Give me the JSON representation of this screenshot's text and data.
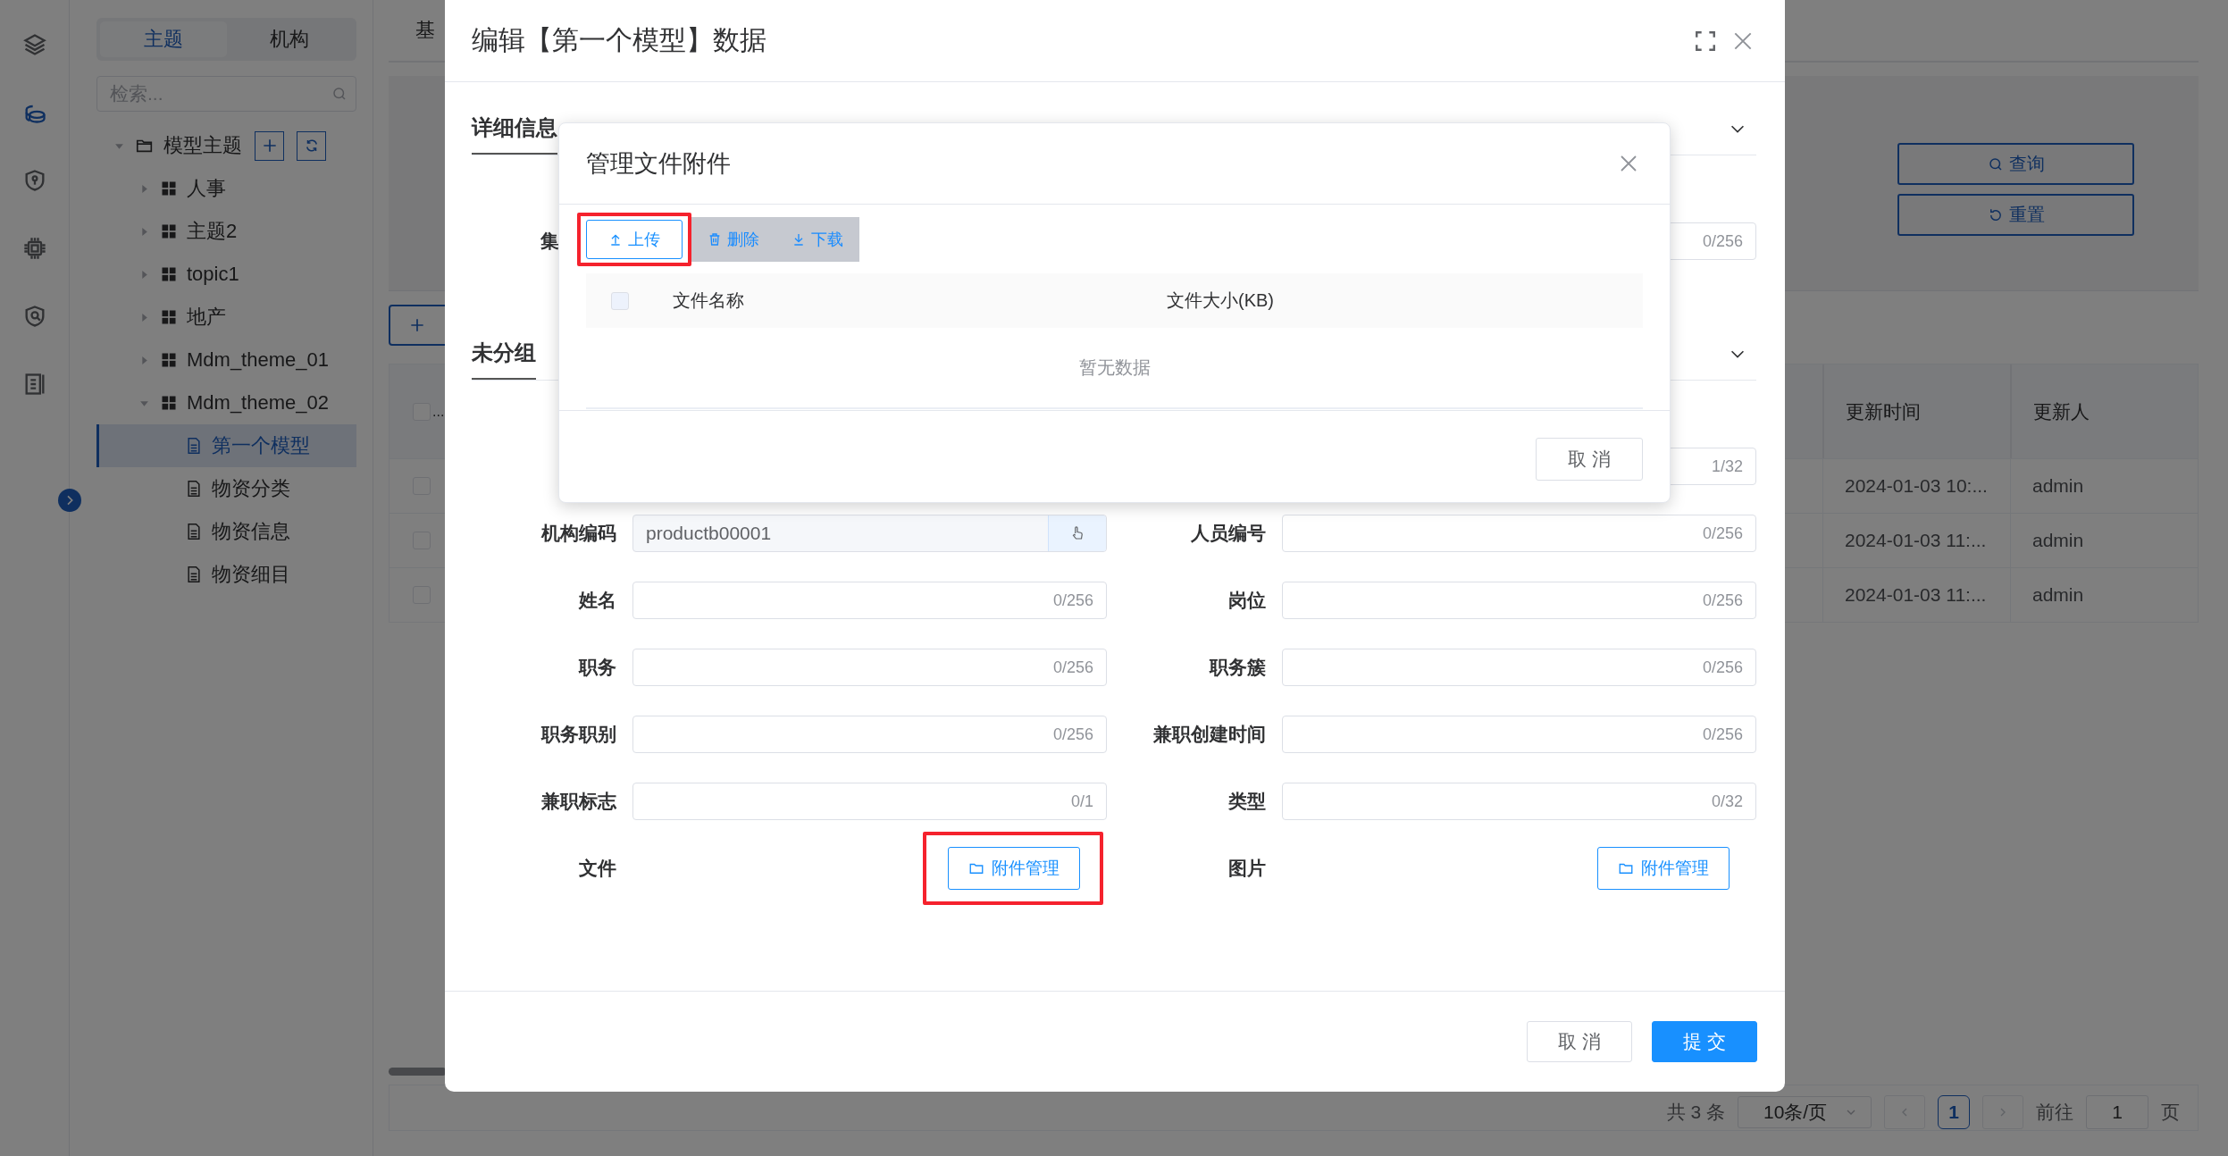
{
  "rail": {
    "items": [
      {
        "kind": "layers",
        "selected": false
      },
      {
        "kind": "database",
        "selected": true
      },
      {
        "kind": "shield-key",
        "selected": false
      },
      {
        "kind": "chip",
        "selected": false
      },
      {
        "kind": "shield-search",
        "selected": false
      },
      {
        "kind": "list",
        "selected": false
      }
    ]
  },
  "sidebar": {
    "tabs": [
      {
        "label": "主题",
        "selected": true
      },
      {
        "label": "机构",
        "selected": false
      }
    ],
    "search": {
      "placeholder": "检索..."
    },
    "tree": [
      {
        "label": "模型主题",
        "kind": "folder",
        "expanded": true,
        "selected": false,
        "children": [
          {
            "label": "人事",
            "kind": "theme",
            "expanded": false,
            "selected": false
          },
          {
            "label": "主题2",
            "kind": "theme",
            "expanded": false,
            "selected": false
          },
          {
            "label": "topic1",
            "kind": "theme",
            "expanded": false,
            "selected": false
          },
          {
            "label": "地产",
            "kind": "theme",
            "expanded": false,
            "selected": false
          },
          {
            "label": "Mdm_theme_01",
            "kind": "theme",
            "expanded": false,
            "selected": false
          },
          {
            "label": "Mdm_theme_02",
            "kind": "theme",
            "expanded": true,
            "selected": false,
            "children": [
              {
                "label": "第一个模型",
                "kind": "model",
                "selected": true
              },
              {
                "label": "物资分类",
                "kind": "model",
                "selected": false
              },
              {
                "label": "物资信息",
                "kind": "model",
                "selected": false
              },
              {
                "label": "物资细目",
                "kind": "model",
                "selected": false
              }
            ]
          }
        ]
      }
    ]
  },
  "main": {
    "tab": "基",
    "search_buttons": [
      {
        "kind": "search",
        "label": "查询"
      },
      {
        "kind": "reset",
        "label": "重置"
      }
    ],
    "table": {
      "header_checked": false,
      "header_cut": "...",
      "columns": [
        "更新时间",
        "更新人"
      ],
      "rows": [
        {
          "checked": false,
          "updated": "2024-01-03 10:...",
          "updater": "admin"
        },
        {
          "checked": false,
          "updated": "2024-01-03 11:...",
          "updater": "admin"
        },
        {
          "checked": false,
          "updated": "2024-01-03 11:...",
          "updater": "admin"
        }
      ]
    },
    "pagination": {
      "total": "共 3 条",
      "page_size": "10条/页",
      "pages": [
        {
          "label": "1",
          "selected": true
        }
      ],
      "goto": "前往",
      "goto_value": "1",
      "suffix": "页"
    }
  },
  "edit_dialog": {
    "title": "编辑【第一个模型】数据",
    "sections": [
      {
        "title": "详细信息",
        "expanded": true,
        "partial_rows": [
          {
            "label": "集",
            "count": "0/256"
          }
        ]
      },
      {
        "title": "未分组",
        "expanded": true,
        "partial_rows": [
          {
            "count": "1/32"
          }
        ],
        "fields": [
          {
            "label": "机构编码",
            "kind": "locked",
            "value": "productb00001"
          },
          {
            "label": "人员编号",
            "kind": "text",
            "count": "0/256"
          },
          {
            "label": "姓名",
            "kind": "text",
            "count": "0/256"
          },
          {
            "label": "岗位",
            "kind": "text",
            "count": "0/256"
          },
          {
            "label": "职务",
            "kind": "text",
            "count": "0/256"
          },
          {
            "label": "职务簇",
            "kind": "text",
            "count": "0/256"
          },
          {
            "label": "职务职别",
            "kind": "text",
            "count": "0/256"
          },
          {
            "label": "兼职创建时间",
            "kind": "text",
            "count": "0/256"
          },
          {
            "label": "兼职标志",
            "kind": "text",
            "count": "0/1"
          },
          {
            "label": "类型",
            "kind": "text",
            "count": "0/32"
          },
          {
            "label": "文件",
            "kind": "attachment",
            "button": "附件管理",
            "highlighted": true
          },
          {
            "label": "图片",
            "kind": "attachment",
            "button": "附件管理",
            "highlighted": false
          }
        ]
      }
    ],
    "buttons": [
      {
        "label": "取 消",
        "kind": "default"
      },
      {
        "label": "提 交",
        "kind": "primary"
      }
    ]
  },
  "attachment_dialog": {
    "title": "管理文件附件",
    "toolbar": [
      {
        "label": "上传",
        "kind": "upload",
        "highlighted": true,
        "disabled": false
      },
      {
        "label": "删除",
        "kind": "delete",
        "highlighted": false,
        "disabled": true
      },
      {
        "label": "下载",
        "kind": "download",
        "highlighted": false,
        "disabled": true
      }
    ],
    "table": {
      "header_checked": false,
      "columns": [
        "文件名称",
        "文件大小(KB)"
      ],
      "empty_text": "暂无数据"
    },
    "buttons": [
      {
        "label": "取 消"
      }
    ]
  }
}
